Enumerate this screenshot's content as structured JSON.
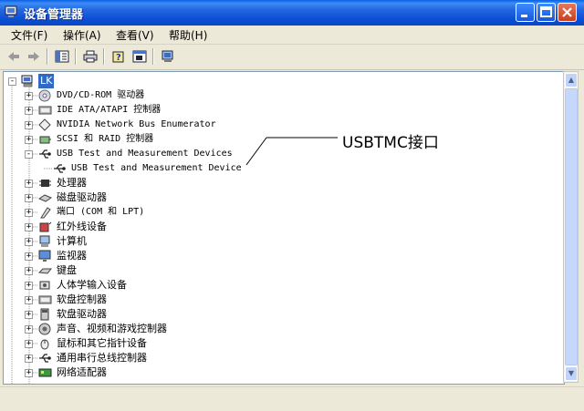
{
  "window": {
    "title": "设备管理器"
  },
  "menu": [
    "文件(F)",
    "操作(A)",
    "查看(V)",
    "帮助(H)"
  ],
  "toolbar": {
    "back": "back-arrow-icon",
    "forward": "forward-arrow-icon",
    "icons": [
      "show-hide-console-tree-icon",
      "print-icon",
      "help-icon",
      "properties-icon",
      "scan-hardware-icon"
    ]
  },
  "tree": {
    "root": "LK",
    "items": [
      {
        "label": "DVD/CD-ROM 驱动器",
        "icon": "cdrom-icon",
        "expander": "+"
      },
      {
        "label": "IDE ATA/ATAPI 控制器",
        "icon": "ide-controller-icon",
        "expander": "+"
      },
      {
        "label": "NVIDIA Network Bus Enumerator",
        "icon": "network-bus-icon",
        "expander": "+"
      },
      {
        "label": "SCSI 和 RAID 控制器",
        "icon": "scsi-icon",
        "expander": "+"
      },
      {
        "label": "USB Test and Measurement Devices",
        "icon": "usb-icon",
        "expander": "-"
      },
      {
        "label": "USB Test and Measurement Device",
        "icon": "usb-icon",
        "expander": "",
        "child": true
      },
      {
        "label": "处理器",
        "icon": "processor-icon",
        "expander": "+"
      },
      {
        "label": "磁盘驱动器",
        "icon": "disk-drive-icon",
        "expander": "+"
      },
      {
        "label": "端口 (COM 和 LPT)",
        "icon": "port-icon",
        "expander": "+"
      },
      {
        "label": "红外线设备",
        "icon": "infrared-icon",
        "expander": "+"
      },
      {
        "label": "计算机",
        "icon": "computer-icon",
        "expander": "+"
      },
      {
        "label": "监视器",
        "icon": "monitor-icon",
        "expander": "+"
      },
      {
        "label": "键盘",
        "icon": "keyboard-icon",
        "expander": "+"
      },
      {
        "label": "人体学输入设备",
        "icon": "hid-icon",
        "expander": "+"
      },
      {
        "label": "软盘控制器",
        "icon": "floppy-controller-icon",
        "expander": "+"
      },
      {
        "label": "软盘驱动器",
        "icon": "floppy-drive-icon",
        "expander": "+"
      },
      {
        "label": "声音、视频和游戏控制器",
        "icon": "sound-icon",
        "expander": "+"
      },
      {
        "label": "鼠标和其它指针设备",
        "icon": "mouse-icon",
        "expander": "+"
      },
      {
        "label": "通用串行总线控制器",
        "icon": "usb-icon",
        "expander": "+"
      },
      {
        "label": "网络适配器",
        "icon": "network-adapter-icon",
        "expander": "+"
      }
    ]
  },
  "annotation": {
    "text": "USBTMC接口"
  },
  "colors": {
    "titlebar": "#0a46c4",
    "selection": "#316ac5",
    "window": "#ece9d8"
  }
}
